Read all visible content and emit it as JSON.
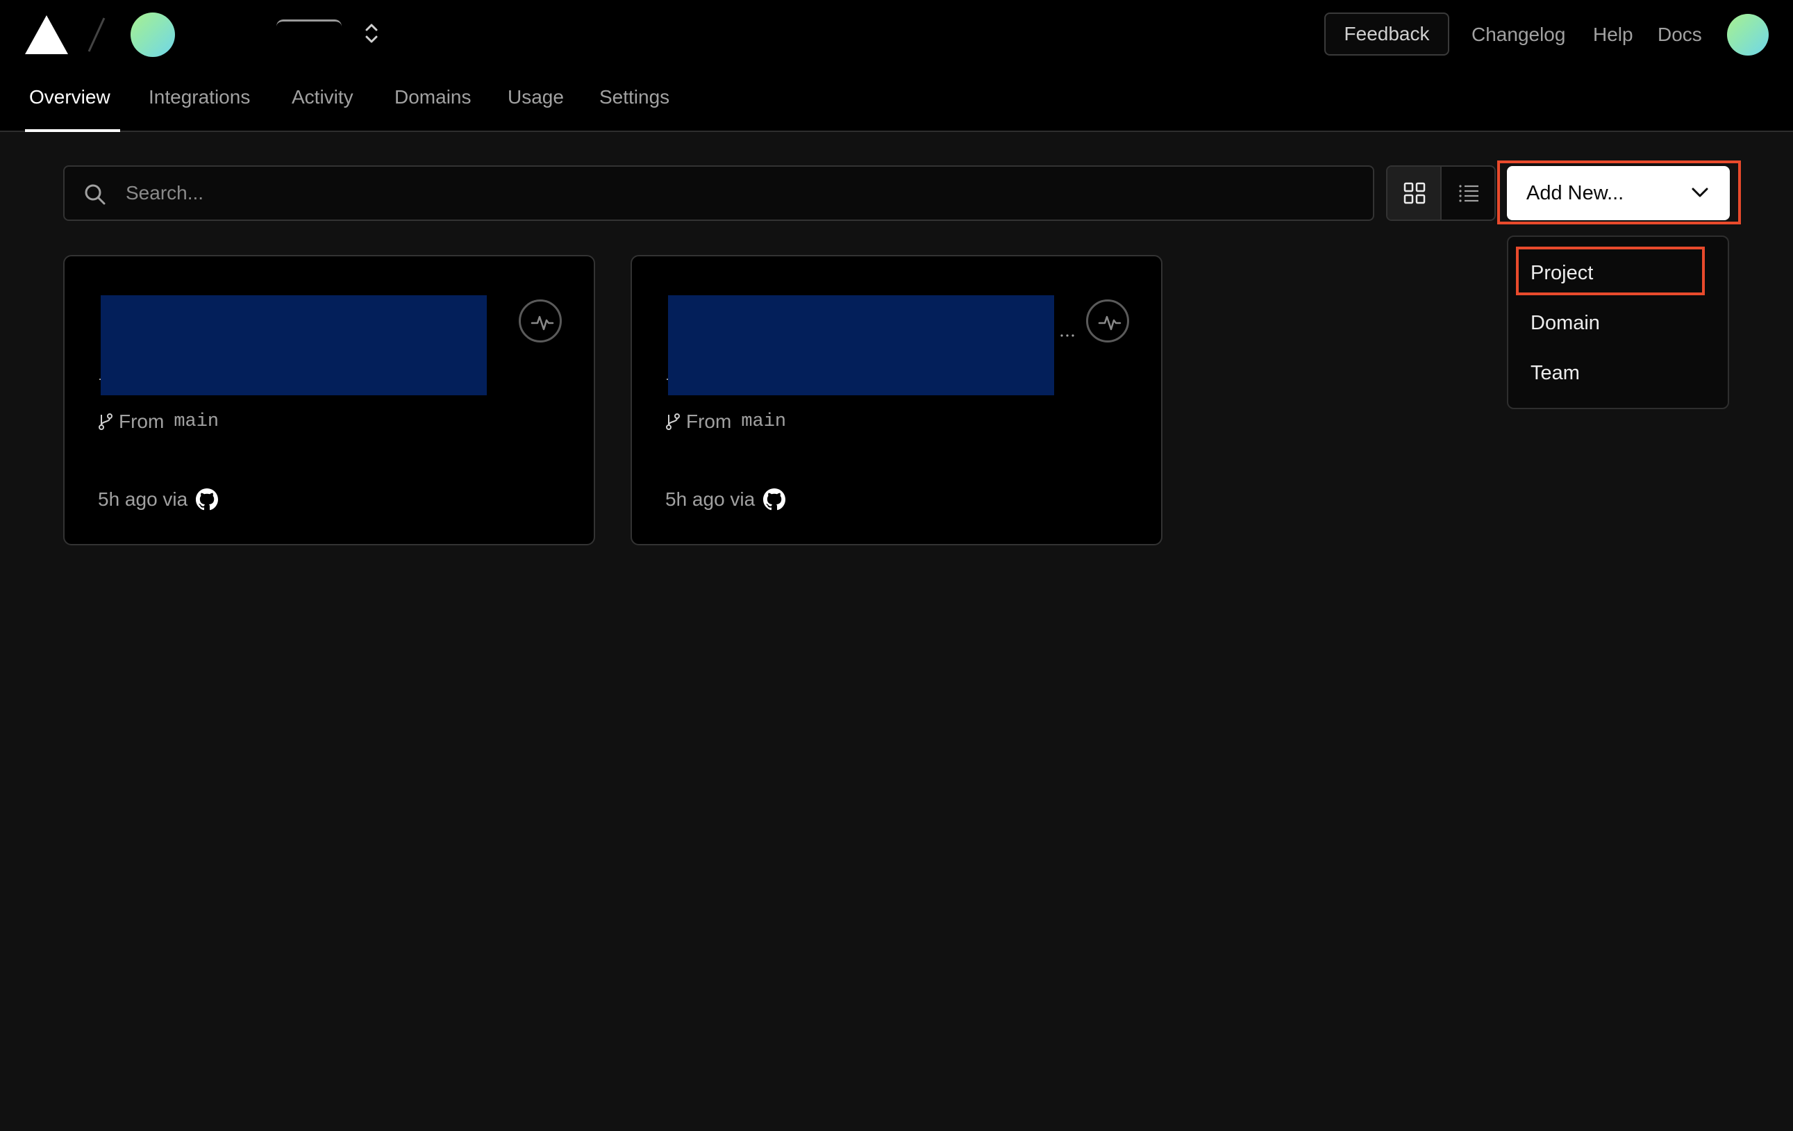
{
  "header": {
    "feedback_label": "Feedback",
    "links": [
      "Changelog",
      "Help",
      "Docs"
    ]
  },
  "tabs": [
    {
      "label": "Overview",
      "active": true
    },
    {
      "label": "Integrations",
      "active": false
    },
    {
      "label": "Activity",
      "active": false
    },
    {
      "label": "Domains",
      "active": false
    },
    {
      "label": "Usage",
      "active": false
    },
    {
      "label": "Settings",
      "active": false
    }
  ],
  "toolbar": {
    "search_placeholder": "Search...",
    "add_new_label": "Add New...",
    "view_mode": "grid"
  },
  "add_new_menu": {
    "items": [
      "Project",
      "Domain",
      "Team"
    ],
    "highlighted": "Project"
  },
  "projects": [
    {
      "name": "",
      "from_label": "From",
      "branch": "main",
      "updated": "5h ago via",
      "source_icon": "github-icon"
    },
    {
      "name": "",
      "from_label": "From",
      "branch": "main",
      "updated": "5h ago via",
      "source_icon": "github-icon"
    }
  ],
  "colors": {
    "background": "#111111",
    "header_bg": "#000000",
    "highlight_border": "#e84a2c",
    "redaction": "#031f5a",
    "avatar_gradient_start": "#a8f08f",
    "avatar_gradient_end": "#6fd6ea"
  }
}
